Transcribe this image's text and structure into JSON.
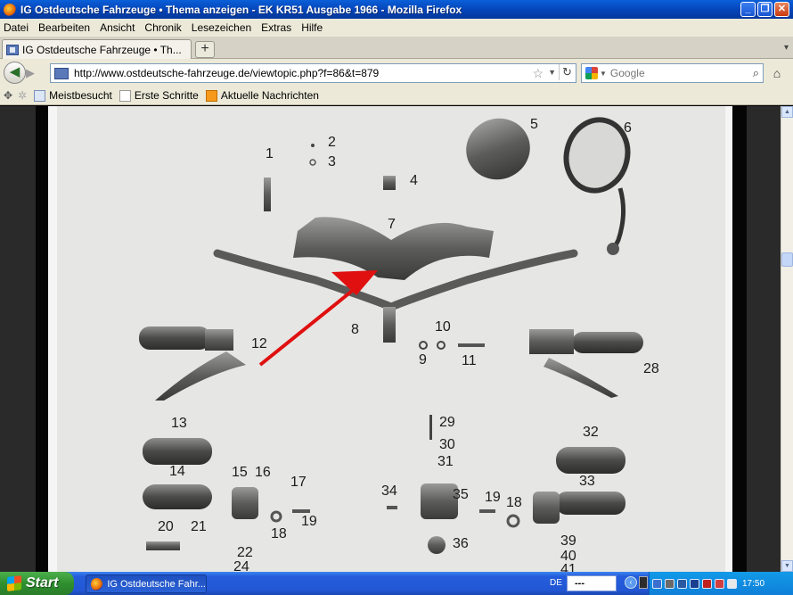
{
  "window": {
    "title": "IG Ostdeutsche Fahrzeuge • Thema anzeigen - EK KR51 Ausgabe 1966 - Mozilla Firefox",
    "minimize": "_",
    "maximize": "❐",
    "close": "✕"
  },
  "menu": [
    "Datei",
    "Bearbeiten",
    "Ansicht",
    "Chronik",
    "Lesezeichen",
    "Extras",
    "Hilfe"
  ],
  "tab": {
    "label": "IG Ostdeutsche Fahrzeuge • Th...",
    "new_tab": "+"
  },
  "nav": {
    "url": "http://www.ostdeutsche-fahrzeuge.de/viewtopic.php?f=86&t=879",
    "search_placeholder": "Google"
  },
  "bookmarks": [
    "Meistbesucht",
    "Erste Schritte",
    "Aktuelle Nachrichten"
  ],
  "diagram": {
    "part_numbers": [
      "1",
      "2",
      "3",
      "4",
      "5",
      "6",
      "7",
      "8",
      "9",
      "10",
      "11",
      "12",
      "13",
      "14",
      "15",
      "16",
      "17",
      "18",
      "19",
      "20",
      "21",
      "22",
      "24",
      "28",
      "29",
      "30",
      "31",
      "32",
      "33",
      "34",
      "35",
      "19",
      "18",
      "36",
      "39",
      "40",
      "41"
    ]
  },
  "taskbar": {
    "start": "Start",
    "task": "IG Ostdeutsche Fahr...",
    "lang": "DE",
    "input": "---",
    "time": "17:50"
  }
}
